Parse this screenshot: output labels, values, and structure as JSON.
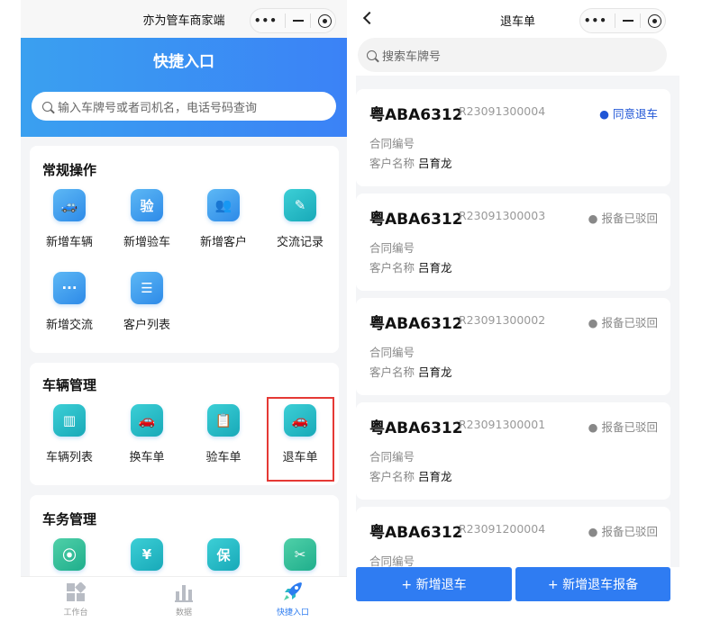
{
  "left": {
    "app_title": "亦为管车商家端",
    "capsule": {
      "more": "•••"
    },
    "hero_title": "快捷入口",
    "search_placeholder": "输入车牌号或者司机名，电话号码查询",
    "sections": [
      {
        "title": "常规操作",
        "items": [
          {
            "label": "新增车辆",
            "icon": "car-icon",
            "glyph": "🚙"
          },
          {
            "label": "新增验车",
            "icon": "inspect-icon",
            "glyph": "验"
          },
          {
            "label": "新增客户",
            "icon": "users-icon",
            "glyph": "👥"
          },
          {
            "label": "交流记录",
            "icon": "note-icon",
            "glyph": "✎"
          },
          {
            "label": "新增交流",
            "icon": "chat-icon",
            "glyph": "···"
          },
          {
            "label": "客户列表",
            "icon": "list-icon",
            "glyph": "☰"
          }
        ]
      },
      {
        "title": "车辆管理",
        "items": [
          {
            "label": "车辆列表",
            "icon": "chart-icon",
            "glyph": "▥"
          },
          {
            "label": "换车单",
            "icon": "swap-car-icon",
            "glyph": "🚗"
          },
          {
            "label": "验车单",
            "icon": "clipboard-icon",
            "glyph": "📋"
          },
          {
            "label": "退车单",
            "icon": "return-car-icon",
            "glyph": "🚗"
          }
        ]
      },
      {
        "title": "车务管理",
        "items": [
          {
            "label": "",
            "icon": "traffic-light-icon",
            "glyph": "⦿"
          },
          {
            "label": "",
            "icon": "yen-icon",
            "glyph": "¥"
          },
          {
            "label": "",
            "icon": "insurance-icon",
            "glyph": "保"
          },
          {
            "label": "",
            "icon": "tools-icon",
            "glyph": "✂"
          }
        ]
      }
    ],
    "tabbar": [
      {
        "label": "工作台",
        "icon": "workbench-icon"
      },
      {
        "label": "数据",
        "icon": "data-icon"
      },
      {
        "label": "快捷入口",
        "icon": "rocket-icon"
      }
    ]
  },
  "right": {
    "page_title": "退车单",
    "search_placeholder": "搜索车牌号",
    "contract_label": "合同编号",
    "customer_label": "客户名称",
    "records": [
      {
        "plate": "粤ABA6312",
        "code": "R23091300004",
        "status": "● 同意退车",
        "status_color": "#1f55d6",
        "customer": "吕育龙"
      },
      {
        "plate": "粤ABA6312",
        "code": "R23091300003",
        "status": "● 报备已驳回",
        "status_color": "#888888",
        "customer": "吕育龙"
      },
      {
        "plate": "粤ABA6312",
        "code": "R23091300002",
        "status": "● 报备已驳回",
        "status_color": "#888888",
        "customer": "吕育龙"
      },
      {
        "plate": "粤ABA6312",
        "code": "R23091300001",
        "status": "● 报备已驳回",
        "status_color": "#888888",
        "customer": "吕育龙"
      },
      {
        "plate": "粤ABA6312",
        "code": "R23091200004",
        "status": "● 报备已驳回",
        "status_color": "#888888",
        "customer": ""
      }
    ],
    "buttons": {
      "add_return": "+ 新增退车",
      "add_return_report": "+ 新增退车报备"
    }
  },
  "colors": {
    "brand_blue": "#3b82f6",
    "highlight_red": "#e53935",
    "status_blue": "#1f55d6"
  }
}
